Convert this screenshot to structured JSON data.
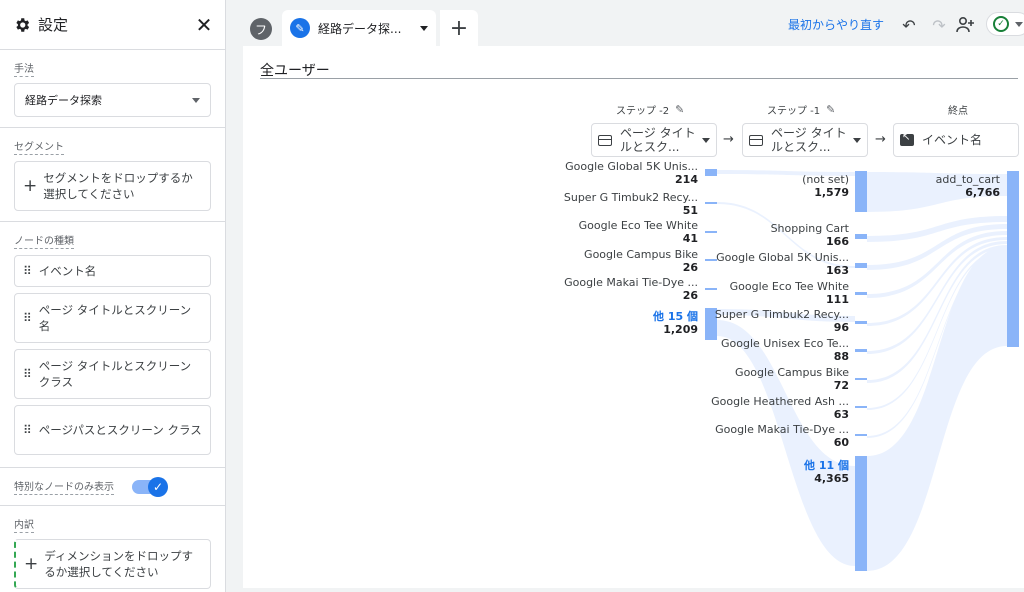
{
  "panel": {
    "title": "設定",
    "technique_label": "手法",
    "technique_value": "経路データ探索",
    "segment_label": "セグメント",
    "segment_placeholder": "セグメントをドロップするか選択してください",
    "node_type_label": "ノードの種類",
    "node_types": [
      "イベント名",
      "ページ タイトルとスクリーン名",
      "ページ タイトルとスクリーンクラス",
      "ページパスとスクリーン クラス"
    ],
    "unique_nodes_label": "特別なノードのみ表示",
    "unique_nodes_on": true,
    "breakdown_label": "内訳",
    "breakdown_placeholder": "ディメンションをドロップするか選択してください"
  },
  "tabs": {
    "round_tab": "フ",
    "active_tab": "経路データ探...",
    "reset_label": "最初からやり直す"
  },
  "canvas": {
    "title": "全ユーザー",
    "step_minus2": {
      "label": "ステップ -2",
      "dimension": "ページ タイトルとスク..."
    },
    "step_minus1": {
      "label": "ステップ -1",
      "dimension": "ページ タイトルとスク..."
    },
    "end": {
      "label": "終点",
      "dimension": "イベント名"
    },
    "col1_nodes": [
      {
        "name": "Google Global 5K Unis...",
        "value": "214"
      },
      {
        "name": "Super G Timbuk2 Recy...",
        "value": "51"
      },
      {
        "name": "Google Eco Tee White",
        "value": "41"
      },
      {
        "name": "Google Campus Bike",
        "value": "26"
      },
      {
        "name": "Google Makai Tie-Dye ...",
        "value": "26"
      }
    ],
    "col1_more": {
      "name": "他 15 個",
      "value": "1,209"
    },
    "col2_nodes": [
      {
        "name": "(not set)",
        "value": "1,579"
      },
      {
        "name": "Shopping Cart",
        "value": "166"
      },
      {
        "name": "Google Global 5K Unis...",
        "value": "163"
      },
      {
        "name": "Google Eco Tee White",
        "value": "111"
      },
      {
        "name": "Super G Timbuk2 Recy...",
        "value": "96"
      },
      {
        "name": "Google Unisex Eco Te...",
        "value": "88"
      },
      {
        "name": "Google Campus Bike",
        "value": "72"
      },
      {
        "name": "Google Heathered Ash ...",
        "value": "63"
      },
      {
        "name": "Google Makai Tie-Dye ...",
        "value": "60"
      }
    ],
    "col2_more": {
      "name": "他 11 個",
      "value": "4,365"
    },
    "end_node": {
      "name": "add_to_cart",
      "value": "6,766"
    },
    "colors": {
      "node": "#8ab4f8",
      "flow": "#e8f0fe"
    }
  }
}
